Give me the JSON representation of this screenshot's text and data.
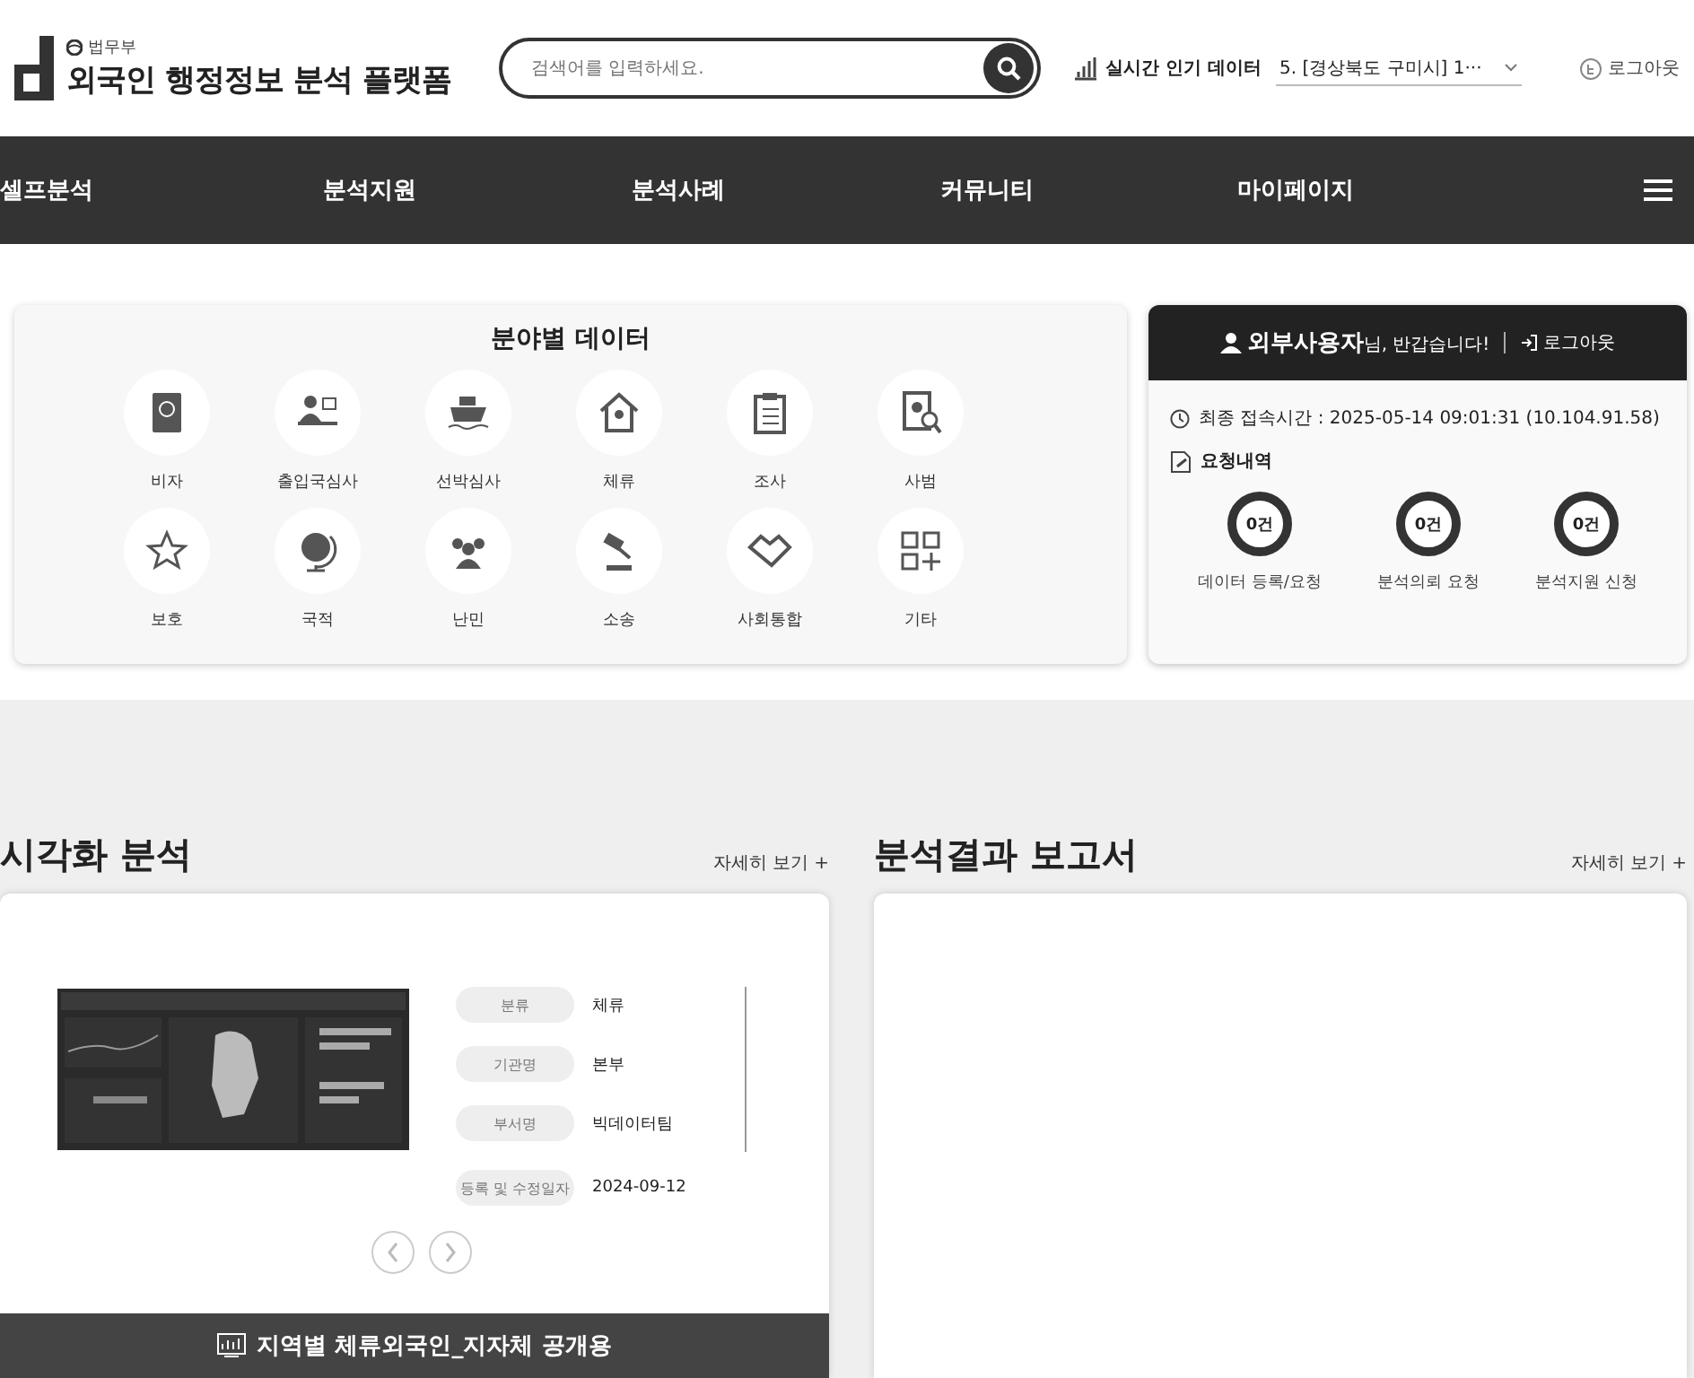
{
  "header": {
    "ministry": "법무부",
    "title": "외국인 행정정보 분석 플랫폼",
    "search": {
      "placeholder": "검색어를 입력하세요."
    },
    "realtime": {
      "label": "실시간 인기 데이터",
      "value": "5. [경상북도 구미시] 1···"
    },
    "logout": "로그아웃"
  },
  "nav": {
    "items": [
      {
        "label": "셀프분석"
      },
      {
        "label": "분석지원"
      },
      {
        "label": "분석사례"
      },
      {
        "label": "커뮤니티"
      },
      {
        "label": "마이페이지"
      }
    ]
  },
  "field_data": {
    "title": "분야별 데이터",
    "items": [
      {
        "label": "비자"
      },
      {
        "label": "출입국심사"
      },
      {
        "label": "선박심사"
      },
      {
        "label": "체류"
      },
      {
        "label": "조사"
      },
      {
        "label": "사범"
      },
      {
        "label": "보호"
      },
      {
        "label": "국적"
      },
      {
        "label": "난민"
      },
      {
        "label": "소송"
      },
      {
        "label": "사회통합"
      },
      {
        "label": "기타"
      }
    ]
  },
  "user_panel": {
    "greeting": "**외부사용자**님, 반갑습니다!",
    "logout": "로그아웃",
    "last_login": "최종 접속시간 : 2025-05-14 09:01:31 (10.104.91.58)",
    "requests_title": "요청내역",
    "requests": [
      {
        "count": "0건",
        "label": "데이터 등록/요청"
      },
      {
        "count": "0건",
        "label": "분석의뢰 요청"
      },
      {
        "count": "0건",
        "label": "분석지원 신청"
      }
    ]
  },
  "visualization": {
    "title": "시각화 분석",
    "more": "자세히 보기 +",
    "details": [
      {
        "label": "분류",
        "value": "체류"
      },
      {
        "label": "기관명",
        "value": "본부"
      },
      {
        "label": "부서명",
        "value": "빅데이터팀"
      },
      {
        "label": "등록 및 수정일자",
        "value": "2024-09-12"
      }
    ],
    "caption": "지역별 체류외국인_지자체 공개용"
  },
  "reports": {
    "title": "분석결과 보고서",
    "more": "자세히 보기 +"
  }
}
